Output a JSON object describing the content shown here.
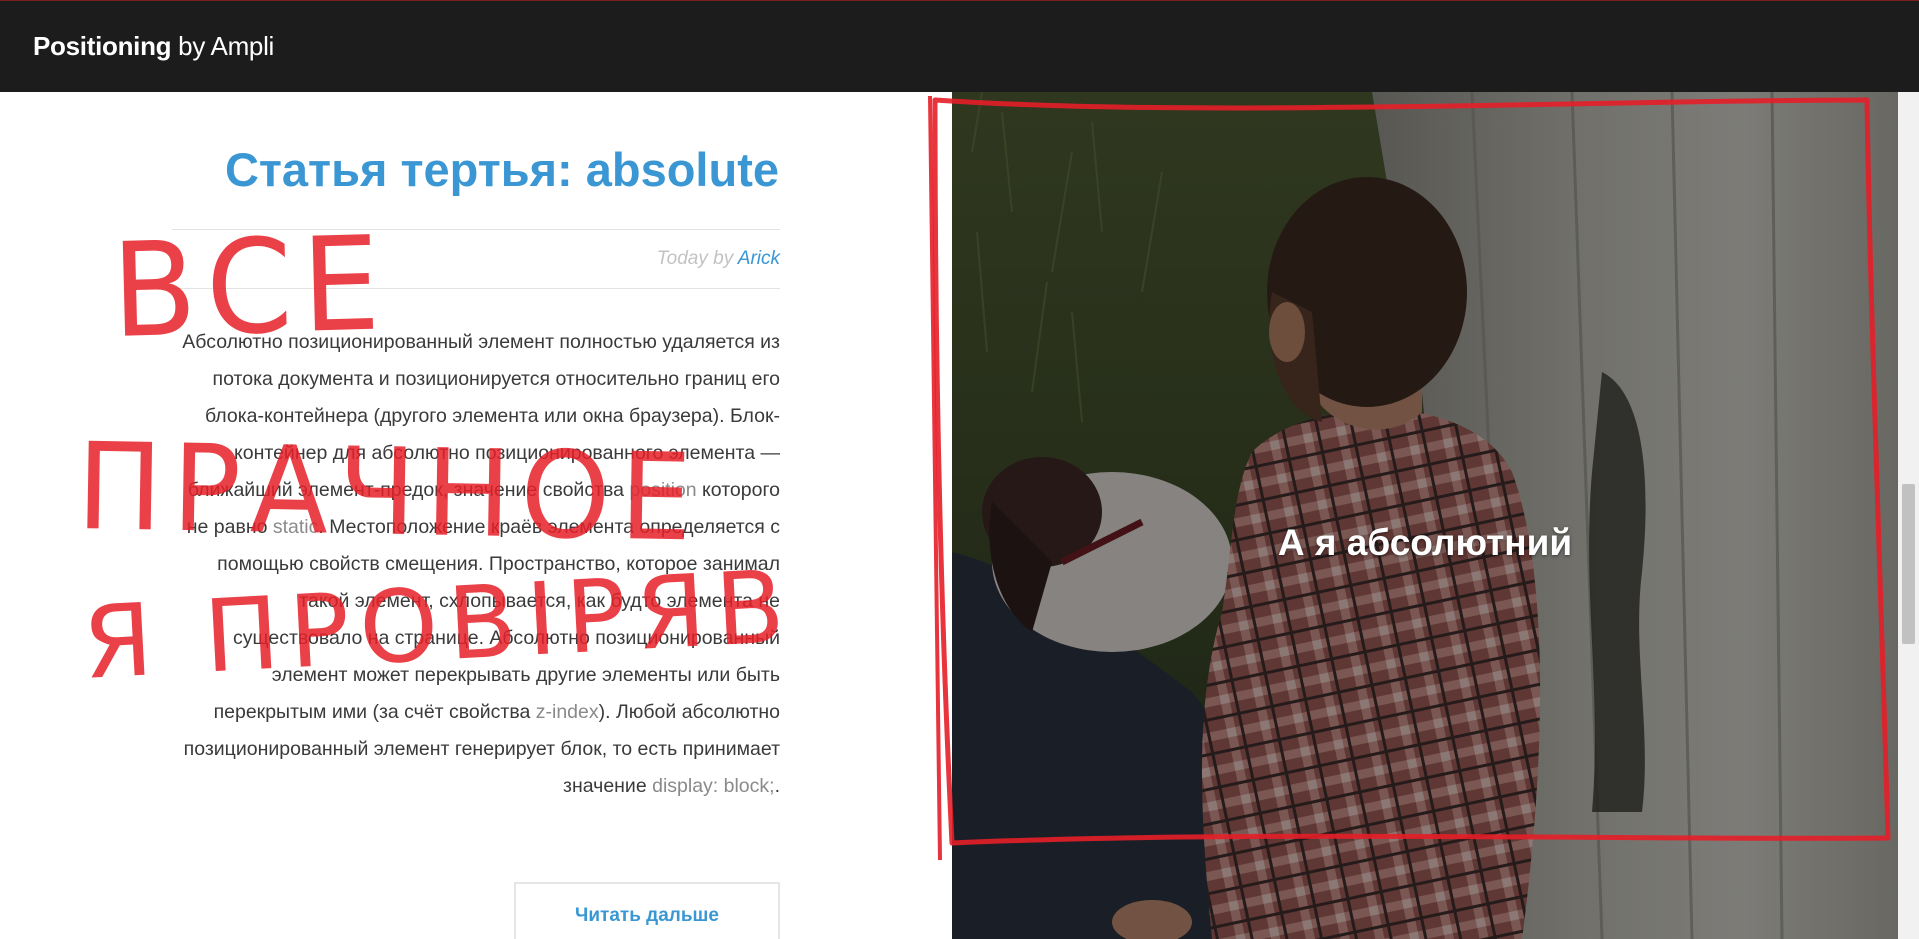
{
  "header": {
    "brand_bold": "Positioning",
    "brand_light": " by Ampli"
  },
  "article": {
    "title": "Статья тертья: absolute",
    "byline_prefix": "Today by ",
    "byline_author": "Arick",
    "body_part1": "Абсолютно позиционированный элемент полностью удаляется из потока документа и позиционируется относительно границ его блока-контейнера (другого элемента или окна браузера). Блок-контейнер для абсолютно позиционированного элемента — ближайший элемент-предок, значение свойства ",
    "code1": "position",
    "body_part2": " которого не равно ",
    "code2": "static",
    "body_part3": ". Местоположение краёв элемента определяется с помощью свойств смещения. Пространство, которое занимал такой элемент, схлопывается, как будто элемента не существовало на странице. Абсолютно позиционированный элемент может перекрывать другие элементы или быть перекрытым ими (за счёт свойства ",
    "code3": "z-index",
    "body_part4": "). Любой абсолютно позиционированный элемент генерирует блок, то есть принимает значение ",
    "code4": "display: block;",
    "body_part5": ".",
    "read_more_label": "Читать дальше"
  },
  "photo": {
    "caption": "А я абсолютний"
  },
  "annotations": {
    "line1": "ВСЕ",
    "line2": "ПРАЧНОЕ",
    "line3": "Я ПРОВІРЯВ"
  },
  "colors": {
    "accent": "#3b97d3",
    "topbar": "#1c1c1c",
    "annotation": "#e61e28"
  }
}
